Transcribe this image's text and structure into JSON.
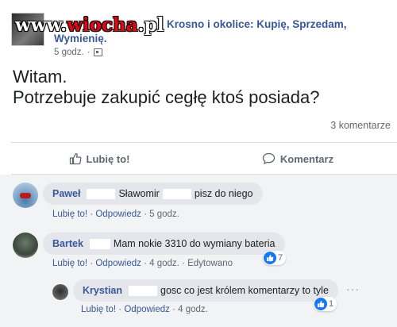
{
  "watermark": {
    "part1": "www.",
    "part2": "wiocha",
    "part3": ".pl"
  },
  "post": {
    "group_title": "Krosno i okolice: Kupię, Sprzedam, Wymienię.",
    "time": "5 godz.",
    "separator": "·",
    "body_line1": "Witam.",
    "body_line2": "Potrzebuje zakupić cegłę ktoś posiada?",
    "comments_count": "3 komentarze"
  },
  "actions": {
    "like_label": "Lubię to!",
    "comment_label": "Komentarz"
  },
  "comments": [
    {
      "name": "Paweł",
      "mention": "Sławomir",
      "text": "pisz do niego",
      "like": "Lubię to!",
      "reply": "Odpowiedz",
      "time": "5 godz."
    },
    {
      "name": "Bartek",
      "text": "Mam nokie 3310 do wymiany bateria",
      "like": "Lubię to!",
      "reply": "Odpowiedz",
      "time": "4 godz.",
      "edited": "Edytowano",
      "reactions": "7"
    },
    {
      "name": "Krystian",
      "text": "gosc co jest królem komentarzy to tyle",
      "like": "Lubię to!",
      "reply": "Odpowiedz",
      "time": "4 godz.",
      "reactions": "1",
      "more": "···"
    }
  ],
  "colors": {
    "link": "#385898",
    "meta": "#606770",
    "bubble": "#e4e6eb",
    "like_blue": "#1877f2",
    "watermark_red": "#e30613"
  }
}
